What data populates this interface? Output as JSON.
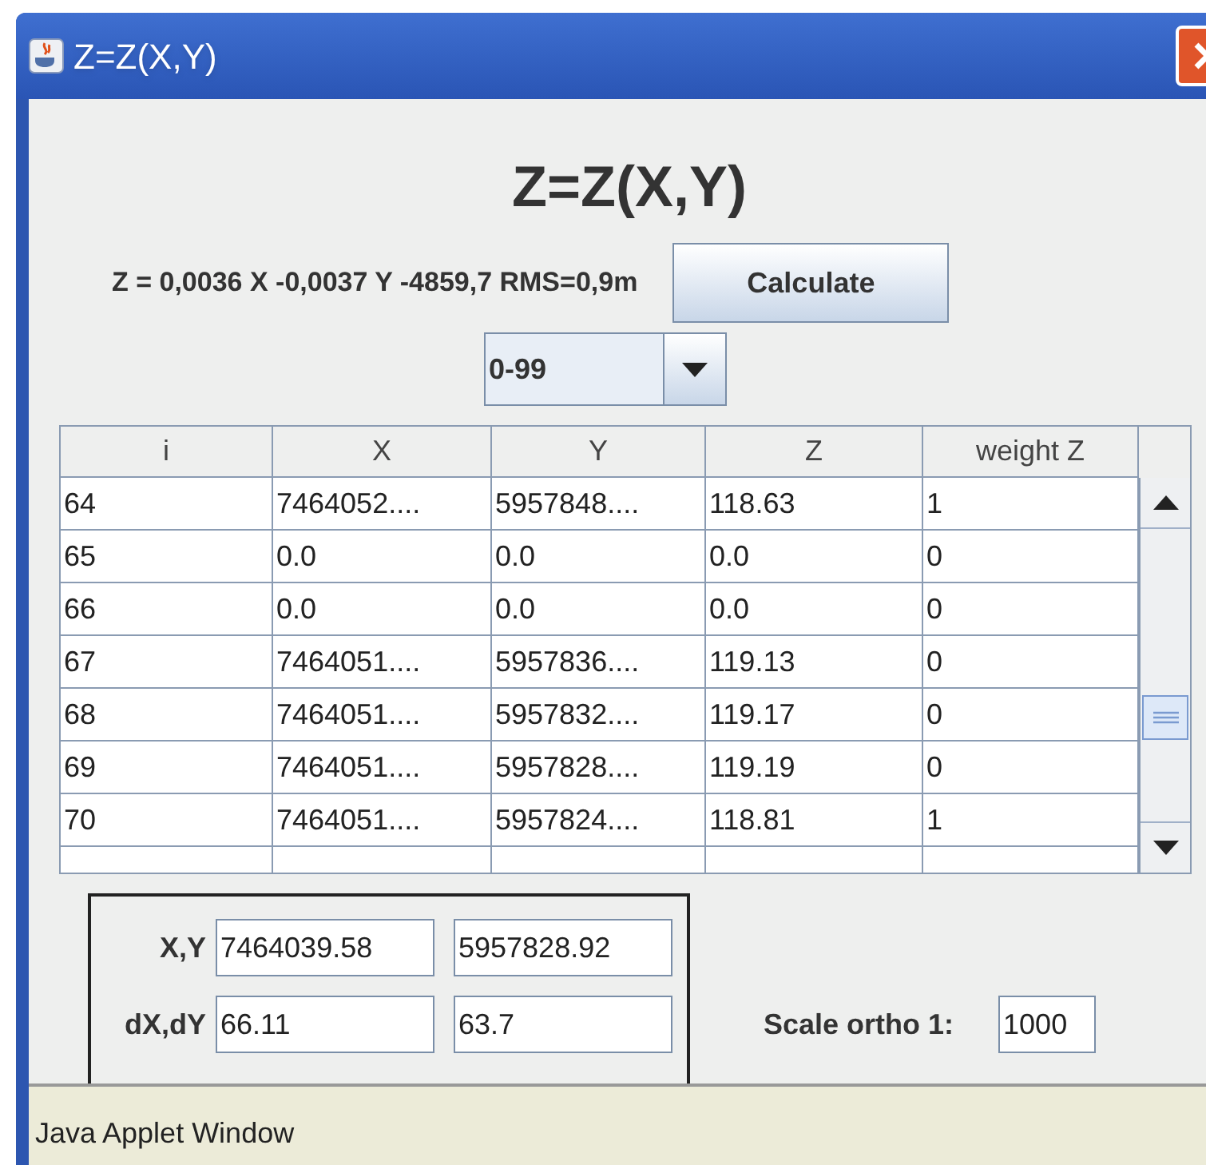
{
  "window": {
    "title": "Z=Z(X,Y)"
  },
  "heading": "Z=Z(X,Y)",
  "equation": "Z = 0,0036 X -0,0037 Y -4859,7 RMS=0,9m",
  "calculate_button": "Calculate",
  "range_select": {
    "value": "0-99"
  },
  "table": {
    "columns": [
      "i",
      "X",
      "Y",
      "Z",
      "weight Z"
    ],
    "rows": [
      [
        "64",
        "7464052....",
        "5957848....",
        "118.63",
        "1"
      ],
      [
        "65",
        "0.0",
        "0.0",
        "0.0",
        "0"
      ],
      [
        "66",
        "0.0",
        "0.0",
        "0.0",
        "0"
      ],
      [
        "67",
        "7464051....",
        "5957836....",
        "119.13",
        "0"
      ],
      [
        "68",
        "7464051....",
        "5957832....",
        "119.17",
        "0"
      ],
      [
        "69",
        "7464051....",
        "5957828....",
        "119.19",
        "0"
      ],
      [
        "70",
        "7464051....",
        "5957824....",
        "118.81",
        "1"
      ]
    ]
  },
  "coordinates": [
    {
      "label": "X,Y",
      "values": [
        "7464039.58",
        "5957828.92"
      ]
    },
    {
      "label": "dX,dY",
      "values": [
        "66.11",
        "63.7"
      ]
    }
  ],
  "scale": {
    "label": "Scale ortho 1:",
    "value": "1000"
  },
  "status_bar": "Java Applet Window"
}
